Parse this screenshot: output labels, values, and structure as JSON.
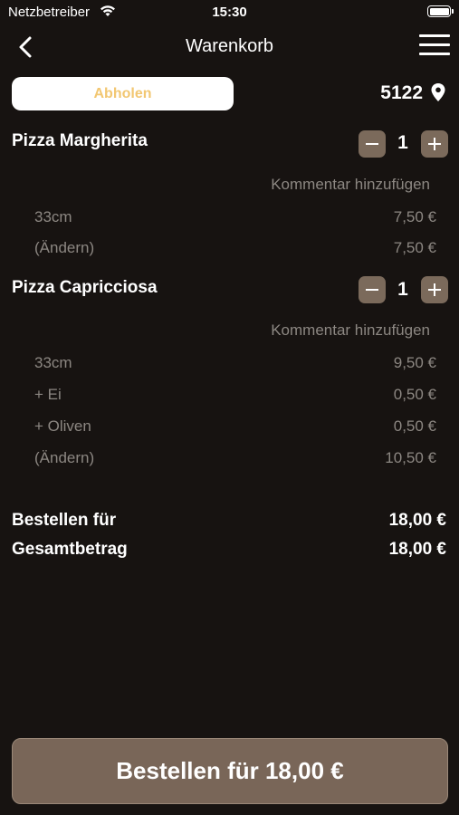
{
  "status_bar": {
    "carrier": "Netzbetreiber",
    "time": "15:30"
  },
  "nav": {
    "title": "Warenkorb"
  },
  "pickup": {
    "label": "Abholen",
    "zip": "5122"
  },
  "items": [
    {
      "name": "Pizza Margherita",
      "qty": "1",
      "comment": "Kommentar hinzufügen",
      "options": [
        {
          "label": "33cm",
          "price": "7,50 €"
        },
        {
          "label": "(Ändern)",
          "price": "7,50 €"
        }
      ]
    },
    {
      "name": "Pizza Capricciosa",
      "qty": "1",
      "comment": "Kommentar hinzufügen",
      "options": [
        {
          "label": "33cm",
          "price": "9,50 €"
        },
        {
          "label": "+ Ei",
          "price": "0,50 €"
        },
        {
          "label": "+ Oliven",
          "price": "0,50 €"
        },
        {
          "label": "(Ändern)",
          "price": "10,50 €"
        }
      ]
    }
  ],
  "totals": {
    "order_for_label": "Bestellen für",
    "order_for_value": "18,00 €",
    "total_label": "Gesamtbetrag",
    "total_value": "18,00 €"
  },
  "order_button": {
    "label": "Bestellen für 18,00 €"
  },
  "colors": {
    "background": "#171311",
    "accent_brown": "#7b6a5b",
    "pickup_text": "#f2c772",
    "muted_text": "#8c8782"
  }
}
